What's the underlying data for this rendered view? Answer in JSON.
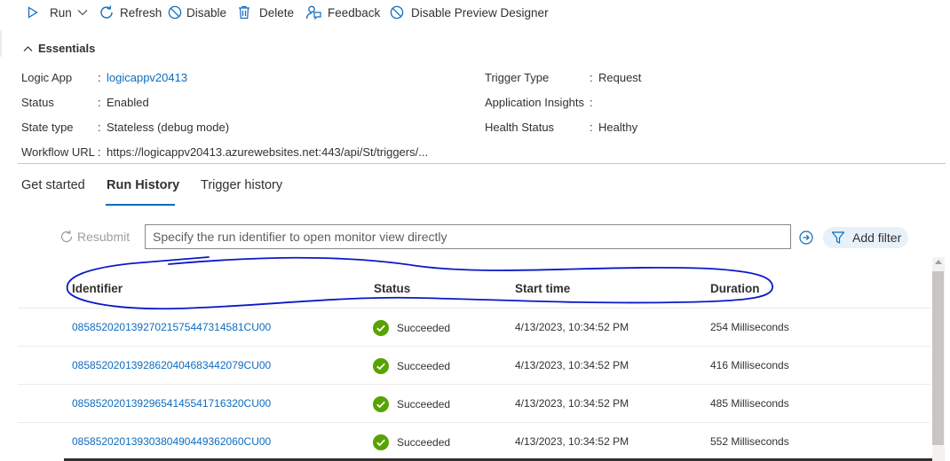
{
  "toolbar": {
    "run": "Run",
    "refresh": "Refresh",
    "disable": "Disable",
    "delete": "Delete",
    "feedback": "Feedback",
    "disable_preview": "Disable Preview Designer"
  },
  "essentials": {
    "title": "Essentials",
    "left": [
      {
        "label": "Logic App",
        "value": "logicappv20413"
      },
      {
        "label": "Status",
        "value": "Enabled"
      },
      {
        "label": "State type",
        "value": "Stateless (debug mode)"
      },
      {
        "label": "Workflow URL",
        "value": "https://logicappv20413.azurewebsites.net:443/api/St/triggers/..."
      }
    ],
    "right": [
      {
        "label": "Trigger Type",
        "value": "Request"
      },
      {
        "label": "Application Insights",
        "value": ""
      },
      {
        "label": "Health Status",
        "value": "Healthy"
      }
    ],
    "colon": ":"
  },
  "tabs": [
    "Get started",
    "Run History",
    "Trigger history"
  ],
  "filter": {
    "resubmit": "Resubmit",
    "search_placeholder": "Specify the run identifier to open monitor view directly",
    "add_filter": "Add filter"
  },
  "table": {
    "headers": [
      "Identifier",
      "Status",
      "Start time",
      "Duration"
    ],
    "rows": [
      {
        "id": "08585202013927021575447314581CU00",
        "status": "Succeeded",
        "start": "4/13/2023, 10:34:52 PM",
        "duration": "254 Milliseconds"
      },
      {
        "id": "08585202013928620404683442079CU00",
        "status": "Succeeded",
        "start": "4/13/2023, 10:34:52 PM",
        "duration": "416 Milliseconds"
      },
      {
        "id": "08585202013929654145541716320CU00",
        "status": "Succeeded",
        "start": "4/13/2023, 10:34:52 PM",
        "duration": "485 Milliseconds"
      },
      {
        "id": "08585202013930380490449362060CU00",
        "status": "Succeeded",
        "start": "4/13/2023, 10:34:52 PM",
        "duration": "552 Milliseconds"
      }
    ]
  },
  "colors": {
    "link": "#0f6cbd",
    "success": "#57a300",
    "annotation": "#0a18c8"
  }
}
